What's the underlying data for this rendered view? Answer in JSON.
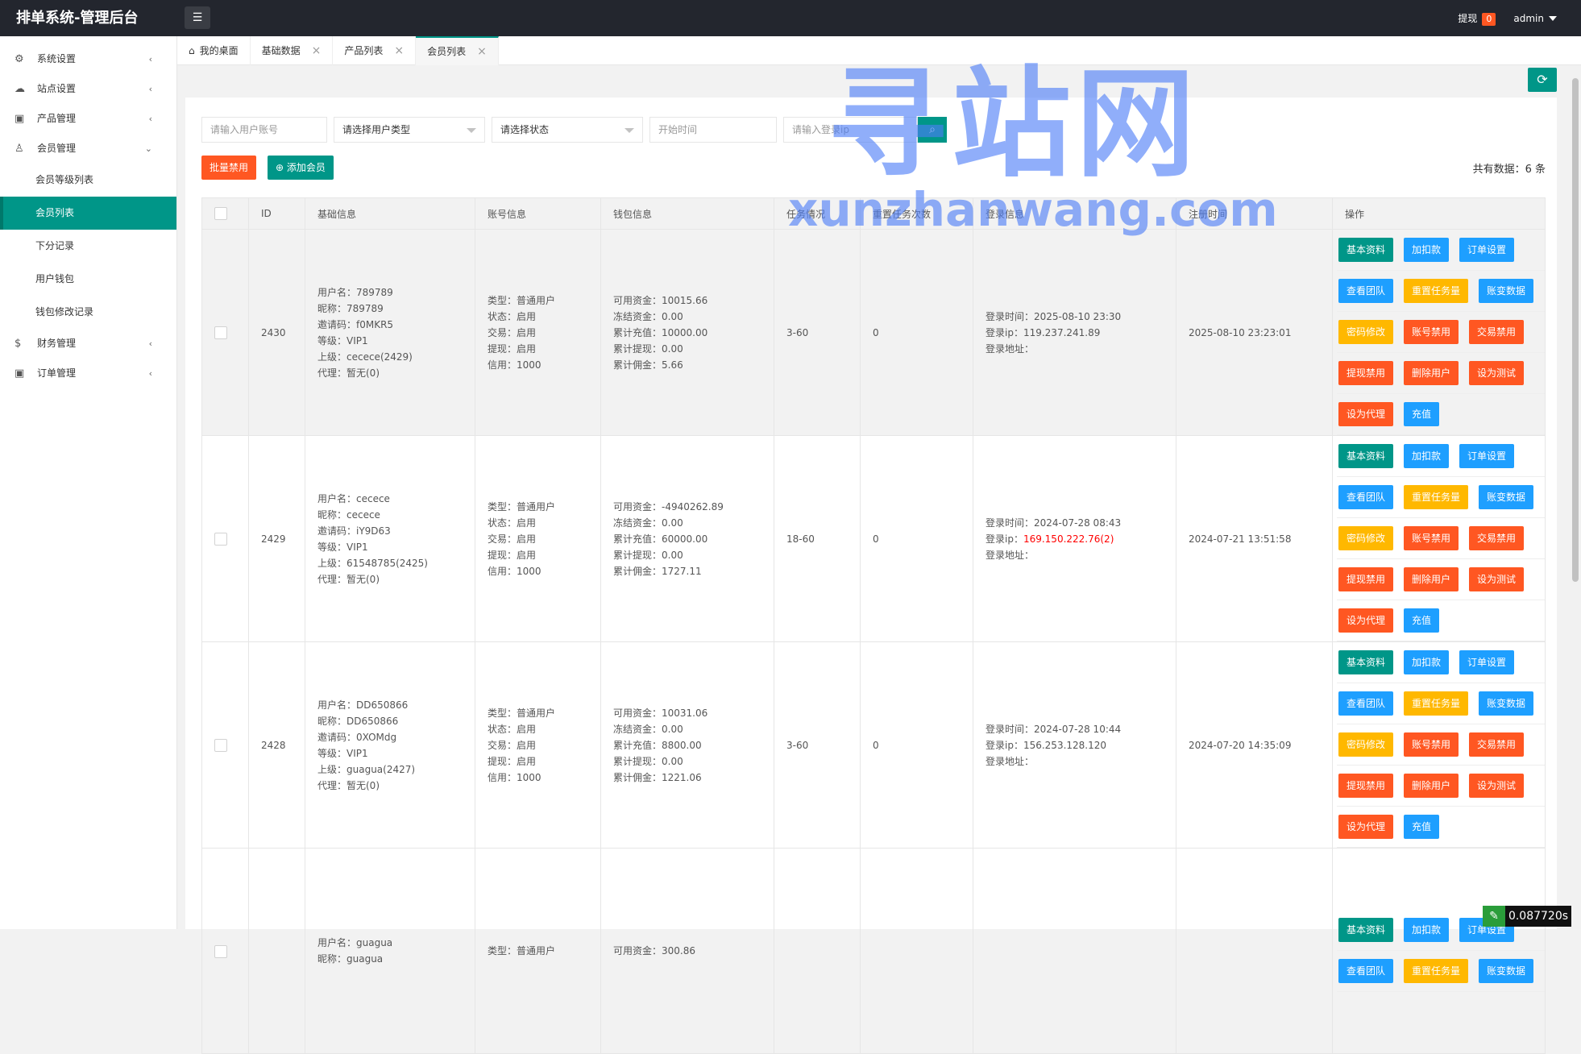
{
  "header": {
    "title": "排单系统-管理后台",
    "menu_icon": "hamburger-icon",
    "withdraw_label": "提现",
    "withdraw_count": "0",
    "user": "admin"
  },
  "sidebar": {
    "items": [
      {
        "label": "系统设置",
        "icon": "gear-icon"
      },
      {
        "label": "站点设置",
        "icon": "cloud-icon"
      },
      {
        "label": "产品管理",
        "icon": "box-icon"
      },
      {
        "label": "会员管理",
        "icon": "user-icon"
      },
      {
        "label": "财务管理",
        "icon": "dollar-icon"
      },
      {
        "label": "订单管理",
        "icon": "box-icon"
      }
    ],
    "member_sub": [
      "会员等级列表",
      "会员列表",
      "下分记录",
      "用户钱包",
      "钱包修改记录"
    ]
  },
  "tabs": [
    {
      "label": "我的桌面"
    },
    {
      "label": "基础数据"
    },
    {
      "label": "产品列表"
    },
    {
      "label": "会员列表"
    }
  ],
  "filters": {
    "account_placeholder": "请输入用户账号",
    "user_type": "请选择用户类型",
    "status": "请选择状态",
    "start_time_placeholder": "开始时间",
    "login_ip_placeholder": "请输入登录ip"
  },
  "actions": {
    "batch_disable": "批量禁用",
    "add_member": "添加会员",
    "total": "共有数据：6 条"
  },
  "table": {
    "headers": [
      "ID",
      "基础信息",
      "账号信息",
      "钱包信息",
      "任务情况",
      "重置任务次数",
      "登录信息",
      "注册时间",
      "操作"
    ],
    "op_buttons": [
      "基本资料",
      "加扣款",
      "订单设置",
      "查看团队",
      "重置任务量",
      "账变数据",
      "密码修改",
      "账号禁用",
      "交易禁用",
      "提现禁用",
      "删除用户",
      "设为测试",
      "设为代理",
      "充值"
    ],
    "rows": [
      {
        "id": "2430",
        "basic": [
          "用户名：789789",
          "昵称：789789",
          "邀请码：f0MKR5",
          "等级：VIP1",
          "上级：cecece(2429)",
          "代理：暂无(0)"
        ],
        "account": [
          "类型：普通用户",
          "状态：启用",
          "交易：启用",
          "提现：启用",
          "信用：1000"
        ],
        "wallet": [
          "可用资金：10015.66",
          "冻结资金：0.00",
          "累计充值：10000.00",
          "累计提现：0.00",
          "累计佣金：5.66"
        ],
        "task": "3-60",
        "reset": "0",
        "login_time": "登录时间：2025-08-10 23:30",
        "login_ip_label": "登录ip：",
        "login_ip": "119.237.241.89",
        "login_addr": "登录地址：",
        "reg_time": "2025-08-10 23:23:01"
      },
      {
        "id": "2429",
        "basic": [
          "用户名：cecece",
          "昵称：cecece",
          "邀请码：iY9D63",
          "等级：VIP1",
          "上级：61548785(2425)",
          "代理：暂无(0)"
        ],
        "account": [
          "类型：普通用户",
          "状态：启用",
          "交易：启用",
          "提现：启用",
          "信用：1000"
        ],
        "wallet": [
          "可用资金：-4940262.89",
          "冻结资金：0.00",
          "累计充值：60000.00",
          "累计提现：0.00",
          "累计佣金：1727.11"
        ],
        "task": "18-60",
        "reset": "0",
        "login_time": "登录时间：2024-07-28 08:43",
        "login_ip_label": "登录ip：",
        "login_ip": "169.150.222.76(2)",
        "login_addr": "登录地址：",
        "reg_time": "2024-07-21 13:51:58"
      },
      {
        "id": "2428",
        "basic": [
          "用户名：DD650866",
          "昵称：DD650866",
          "邀请码：0XOMdg",
          "等级：VIP1",
          "上级：guagua(2427)",
          "代理：暂无(0)"
        ],
        "account": [
          "类型：普通用户",
          "状态：启用",
          "交易：启用",
          "提现：启用",
          "信用：1000"
        ],
        "wallet": [
          "可用资金：10031.06",
          "冻结资金：0.00",
          "累计充值：8800.00",
          "累计提现：0.00",
          "累计佣金：1221.06"
        ],
        "task": "3-60",
        "reset": "0",
        "login_time": "登录时间：2024-07-28 10:44",
        "login_ip_label": "登录ip：",
        "login_ip": "156.253.128.120",
        "login_addr": "登录地址：",
        "reg_time": "2024-07-20 14:35:09"
      },
      {
        "id": "",
        "basic": [
          "用户名：guagua",
          "昵称：guagua"
        ],
        "account": [
          "类型：普通用户"
        ],
        "wallet": [
          "可用资金：300.86"
        ],
        "task": "",
        "reset": "",
        "login_time": "",
        "login_ip_label": "",
        "login_ip": "",
        "login_addr": "",
        "reg_time": ""
      }
    ]
  },
  "watermark": {
    "cn": "寻站网",
    "en": "xunzhanwang.com"
  },
  "timer": "0.087720s",
  "colors": {
    "primary": "#009688",
    "danger": "#ff5722",
    "info": "#1e9fff",
    "warn": "#ffb800",
    "header_bg": "#23262e"
  }
}
